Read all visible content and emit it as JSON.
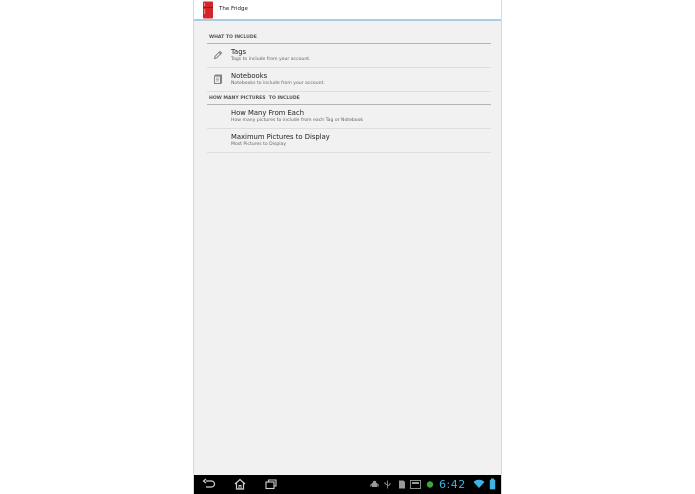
{
  "app": {
    "title": "The Fridge"
  },
  "sections": [
    {
      "header": "What to Include",
      "items": [
        {
          "title": "Tags",
          "summary": "Tags to include from your account.",
          "icon": "pencil-tag-icon"
        },
        {
          "title": "Notebooks",
          "summary": "Notebooks to include from your account.",
          "icon": "notebook-icon"
        }
      ]
    },
    {
      "header": "How many pictures  to include",
      "items": [
        {
          "title": "How Many From Each",
          "summary": "How many pictures to include from each Tag or Notebook"
        },
        {
          "title": "Maximum Pictures to Display",
          "summary": "Most Pictures to Display"
        }
      ]
    }
  ],
  "status_bar": {
    "time": "6:42"
  },
  "colors": {
    "accent": "#3fb2e3",
    "actionbar_underline": "#a9cde5",
    "app_icon": "#d3262a"
  }
}
